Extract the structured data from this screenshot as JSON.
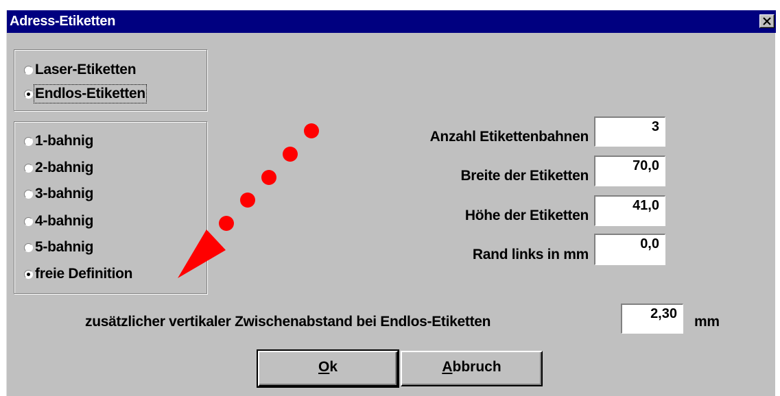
{
  "window": {
    "title": "Adress-Etiketten",
    "close_icon": "close-icon"
  },
  "label_type": {
    "options": [
      {
        "label": "Laser-Etiketten",
        "checked": false
      },
      {
        "label": "Endlos-Etiketten",
        "checked": true
      }
    ]
  },
  "tracks": {
    "options": [
      {
        "label": "1-bahnig",
        "checked": false
      },
      {
        "label": "2-bahnig",
        "checked": false
      },
      {
        "label": "3-bahnig",
        "checked": false
      },
      {
        "label": "4-bahnig",
        "checked": false
      },
      {
        "label": "5-bahnig",
        "checked": false
      },
      {
        "label": "freie Definition",
        "checked": true
      }
    ]
  },
  "fields": {
    "anzahl": {
      "label": "Anzahl Etikettenbahnen",
      "value": "3"
    },
    "breite": {
      "label": "Breite der Etiketten",
      "value": "70,0"
    },
    "hoehe": {
      "label": "Höhe der Etiketten",
      "value": "41,0"
    },
    "rand": {
      "label": "Rand links in mm",
      "value": "0,0"
    }
  },
  "spacing": {
    "label": "zusätzlicher vertikaler Zwischenabstand bei Endlos-Etiketten",
    "value": "2,30",
    "unit": "mm"
  },
  "buttons": {
    "ok": {
      "mnemonic": "O",
      "rest": "k"
    },
    "cancel": {
      "mnemonic": "A",
      "rest": "bbruch"
    }
  },
  "colors": {
    "titlebar": "#000080",
    "face": "#c0c0c0",
    "annotation": "#ff0000"
  }
}
